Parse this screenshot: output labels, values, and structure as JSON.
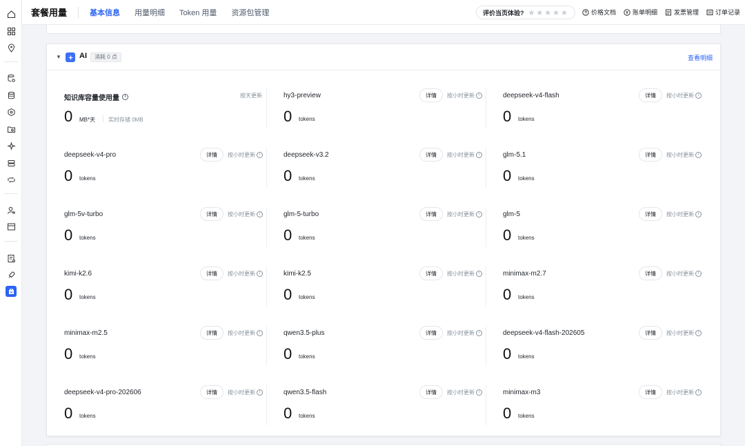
{
  "header": {
    "title": "套餐用量",
    "tabs": [
      {
        "label": "基本信息",
        "active": true
      },
      {
        "label": "用量明细",
        "active": false
      },
      {
        "label": "Token 用量",
        "active": false
      },
      {
        "label": "资源包管理",
        "active": false
      }
    ],
    "rating": {
      "question": "评价当页体验?",
      "stars": [
        "★",
        "★",
        "★",
        "★",
        "★"
      ]
    },
    "links": {
      "pricing": "价格文档",
      "billing": "账单明细",
      "invoice": "发票管理",
      "orders": "订单记录"
    }
  },
  "section": {
    "title": "AI",
    "badge": "消耗 0 点",
    "detail_link": "查看明细",
    "knowledge_base": {
      "name": "知识库容量使用量",
      "update": "按天更新",
      "value": "0",
      "unit": "MB*天",
      "storage": "实时存储 0MB"
    },
    "detail_label": "详情",
    "update_label": "按小时更新",
    "token_unit": "tokens",
    "models": [
      {
        "name": "hy3-preview",
        "value": "0"
      },
      {
        "name": "deepseek-v4-flash",
        "value": "0"
      },
      {
        "name": "deepseek-v4-pro",
        "value": "0"
      },
      {
        "name": "deepseek-v3.2",
        "value": "0"
      },
      {
        "name": "glm-5.1",
        "value": "0"
      },
      {
        "name": "glm-5v-turbo",
        "value": "0"
      },
      {
        "name": "glm-5-turbo",
        "value": "0"
      },
      {
        "name": "glm-5",
        "value": "0"
      },
      {
        "name": "kimi-k2.6",
        "value": "0"
      },
      {
        "name": "kimi-k2.5",
        "value": "0"
      },
      {
        "name": "minimax-m2.7",
        "value": "0"
      },
      {
        "name": "minimax-m2.5",
        "value": "0"
      },
      {
        "name": "qwen3.5-plus",
        "value": "0"
      },
      {
        "name": "deepseek-v4-flash-202605",
        "value": "0"
      },
      {
        "name": "deepseek-v4-pro-202606",
        "value": "0"
      },
      {
        "name": "qwen3.5-flash",
        "value": "0"
      },
      {
        "name": "minimax-m3",
        "value": "0"
      }
    ]
  },
  "colors": {
    "accent": "#2b64f5",
    "muted": "#86909c"
  }
}
